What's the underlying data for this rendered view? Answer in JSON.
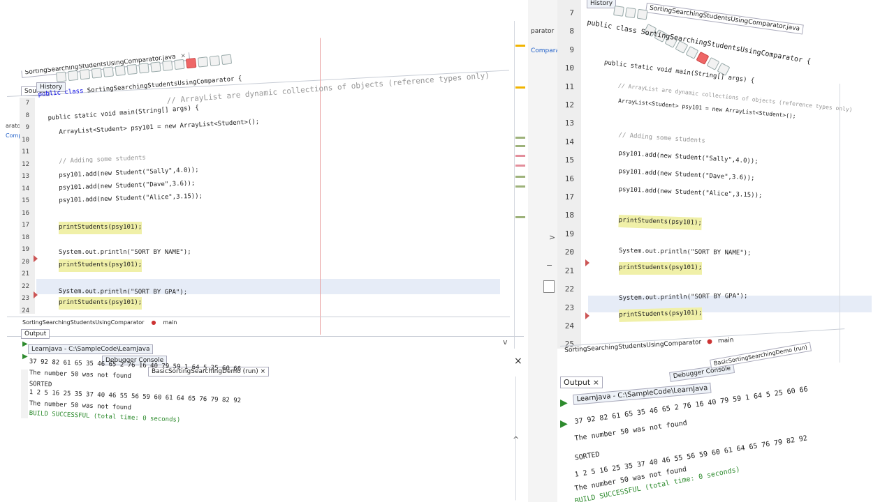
{
  "left": {
    "file_tab": "SortingSearchingStudentsUsingComparator.java",
    "source_tab": "Source",
    "history_tab": "History",
    "side_labels": [
      "arator",
      "Compar"
    ],
    "line_numbers": [
      "7",
      "8",
      "9",
      "10",
      "11",
      "12",
      "13",
      "14",
      "15",
      "16",
      "17",
      "18",
      "19",
      "20",
      "21",
      "22",
      "23",
      "24"
    ],
    "code": {
      "class_decl": "public class SortingSearchingStudentsUsingComparator {",
      "main_decl": "public static void main(String[] args) {",
      "comment_arraylist": "// ArrayList are dynamic collections of objects (reference types only)",
      "arraylist_decl": "ArrayList<Student> psy101 = new ArrayList<Student>();",
      "comment_adding": "// Adding some students",
      "add1": "psy101.add(new Student(\"Sally\",4.0));",
      "add2": "psy101.add(new Student(\"Dave\",3.6));",
      "add3": "psy101.add(new Student(\"Alice\",3.15));",
      "print1": "printStudents(psy101);",
      "println_name": "System.out.println(\"SORT BY NAME\");",
      "print2": "printStudents(psy101);",
      "println_gpa": "System.out.println(\"SORT BY GPA\");",
      "print3": "printStudents(psy101);"
    },
    "breadcrumb": [
      "SortingSearchingStudentsUsingComparator",
      "main"
    ],
    "output_title": "Output",
    "output_tabs": [
      "LearnJava - C:\\SampleCode\\LearnJava",
      "Debugger Console",
      "BasicSortingSearchingDemo (run)"
    ],
    "output_lines": [
      "37 92 82 61 65 35 46 65 2 76 16 40 79 59 1 64 5 25 60 66",
      "The number 50 was not found",
      "SORTED",
      "1 2 5 16 25 35 37 40 46 55 56 59 60 61 64 65 76 79 82 92",
      "The number 50 was not found",
      "BUILD SUCCESSFUL (total time: 0 seconds)"
    ]
  },
  "right": {
    "file_tab": "SortingSearchingStudentsUsingComparator.java",
    "history_tab": "History",
    "side_labels": [
      "parator",
      "Comparat"
    ],
    "line_numbers": [
      "7",
      "8",
      "9",
      "10",
      "11",
      "12",
      "13",
      "14",
      "15",
      "16",
      "17",
      "18",
      "19",
      "20",
      "21",
      "22",
      "23",
      "24",
      "25"
    ],
    "code": {
      "class_decl": "public class SortingSearchingStudentsUsingComparator {",
      "main_decl": "public static void main(String[] args) {",
      "comment_arraylist": "// ArrayList are dynamic collections of objects (reference types only)",
      "arraylist_decl": "ArrayList<Student> psy101 = new ArrayList<Student>();",
      "comment_adding": "// Adding some students",
      "add1": "psy101.add(new Student(\"Sally\",4.0));",
      "add2": "psy101.add(new Student(\"Dave\",3.6));",
      "add3": "psy101.add(new Student(\"Alice\",3.15));",
      "print1": "printStudents(psy101);",
      "println_name": "System.out.println(\"SORT BY NAME\");",
      "print2": "printStudents(psy101);",
      "println_gpa": "System.out.println(\"SORT BY GPA\");",
      "print3": "printStudents(psy101);"
    },
    "breadcrumb": [
      "SortingSearchingStudentsUsingComparator",
      "main"
    ],
    "output_title": "Output",
    "output_tabs": [
      "LearnJava - C:\\SampleCode\\LearnJava",
      "Debugger Console",
      "BasicSortingSearchingDemo (run)"
    ],
    "output_lines": [
      "37 92 82 61 65 35 46 65 2 76 16 40 79 59 1 64 5 25 60 66",
      "The number 50 was not found",
      "SORTED",
      "1 2 5 16 25 35 37 40 46 55 56 59 60 61 64 65 76 79 82 92",
      "The number 50 was not found",
      "BUILD SUCCESSFUL (total time: 0 seconds)"
    ]
  },
  "icons": {
    "close": "×",
    "collapse": "−",
    "scroll_up": "^",
    "scroll_down": "v",
    "arrow_right": ">",
    "run": "▶"
  }
}
